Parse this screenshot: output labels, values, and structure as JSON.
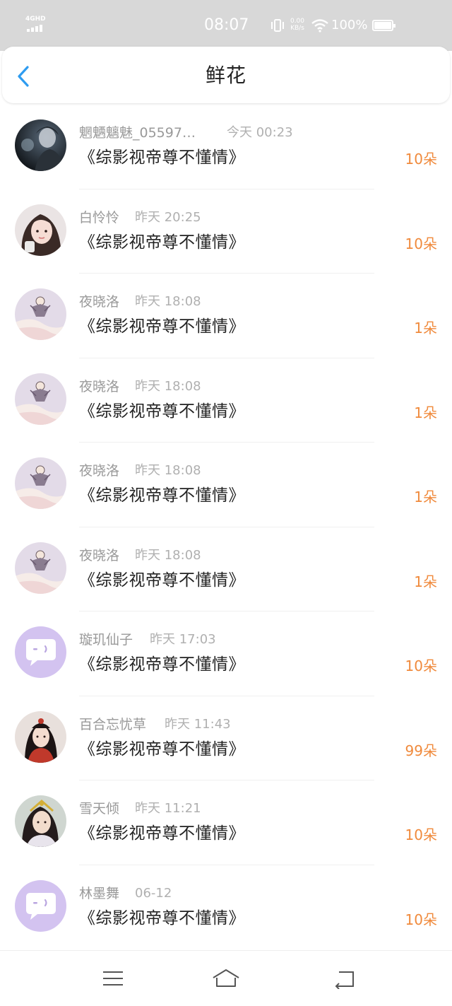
{
  "status_bar": {
    "network": "4GHD",
    "time": "08:07",
    "speed_value": "0.00",
    "speed_unit": "KB/s",
    "battery": "100%"
  },
  "header": {
    "title": "鲜花",
    "back_icon": "chevron-left-icon"
  },
  "colors": {
    "accent_blue": "#2e9cf0",
    "count_orange": "#f08a3c",
    "meta_gray": "#999999",
    "status_bar_bg": "#d8d8d8"
  },
  "records": [
    {
      "name": "魍魉魑魅_05597…",
      "time": "今天 00:23",
      "book": "《综影视帝尊不懂情》",
      "count": "10朵",
      "avatar": "dark-portrait"
    },
    {
      "name": "白怜怜",
      "time": "昨天 20:25",
      "book": "《综影视帝尊不懂情》",
      "count": "10朵",
      "avatar": "girl-portrait"
    },
    {
      "name": "夜晓洛",
      "time": "昨天 18:08",
      "book": "《综影视帝尊不懂情》",
      "count": "1朵",
      "avatar": "fairy-art"
    },
    {
      "name": "夜晓洛",
      "time": "昨天 18:08",
      "book": "《综影视帝尊不懂情》",
      "count": "1朵",
      "avatar": "fairy-art"
    },
    {
      "name": "夜晓洛",
      "time": "昨天 18:08",
      "book": "《综影视帝尊不懂情》",
      "count": "1朵",
      "avatar": "fairy-art"
    },
    {
      "name": "夜晓洛",
      "time": "昨天 18:08",
      "book": "《综影视帝尊不懂情》",
      "count": "1朵",
      "avatar": "fairy-art"
    },
    {
      "name": "璇玑仙子",
      "time": "昨天 17:03",
      "book": "《综影视帝尊不懂情》",
      "count": "10朵",
      "avatar": "default-chat"
    },
    {
      "name": "百合忘忧草",
      "time": "昨天 11:43",
      "book": "《综影视帝尊不懂情》",
      "count": "99朵",
      "avatar": "costume-portrait"
    },
    {
      "name": "雪天倾",
      "time": "昨天 11:21",
      "book": "《综影视帝尊不懂情》",
      "count": "10朵",
      "avatar": "costume-portrait-2"
    },
    {
      "name": "林墨舞",
      "time": "06-12",
      "book": "《综影视帝尊不懂情》",
      "count": "10朵",
      "avatar": "default-chat"
    }
  ],
  "bottom_bar": {
    "menu_icon": "menu-icon",
    "home_icon": "home-icon",
    "back_icon": "return-icon"
  }
}
